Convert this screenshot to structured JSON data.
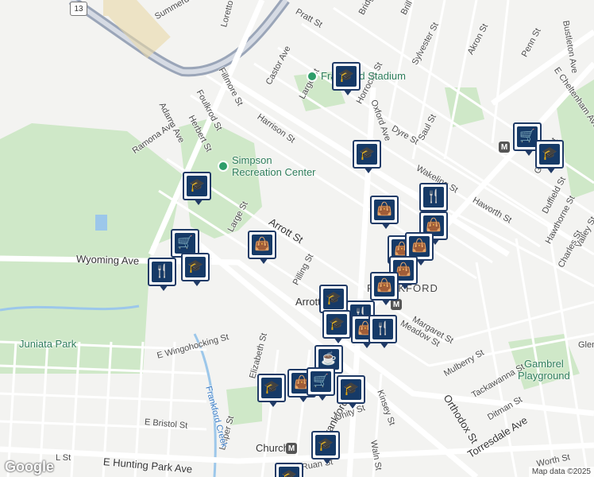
{
  "map": {
    "attribution": "Map data ©2025",
    "logo": "Google",
    "highway_shield": "13",
    "places": [
      {
        "id": "stadium",
        "name": "Frankford Stadium"
      },
      {
        "id": "simpson",
        "name": "Simpson\nRecreation Center"
      },
      {
        "id": "gambrel",
        "name": "Gambrel\nPlayground"
      },
      {
        "id": "juniata",
        "name": "Juniata Park"
      }
    ],
    "neighborhood": "FRANKFORD",
    "stations": [
      "Arrott",
      "Church"
    ],
    "streets": [
      "Summerdale Ave",
      "Pratt St",
      "Castor Ave",
      "Fillmore St",
      "Foulkrod St",
      "Herbert St",
      "Adams Ave",
      "Ramona Ave",
      "Harrison St",
      "Large St",
      "Oxford Ave",
      "Horrocks St",
      "Dyre St",
      "Saul St",
      "Brill St",
      "Sylvester St",
      "Akron St",
      "Penn St",
      "Wakeling St",
      "Haworth St",
      "Arrott St",
      "Wyoming Ave",
      "Pilling St",
      "Margaret St",
      "Orthodox St",
      "Mulberry St",
      "Tackawanna St",
      "Ditman St",
      "Frankford Ave",
      "Kinsey St",
      "Unity St",
      "Waln St",
      "Church",
      "Ruan St",
      "E Hunting Park Ave",
      "E Bristol St",
      "E Wingohocking St",
      "Elizabeth St",
      "Leiper St",
      "Frankford Creek",
      "Torresdale Ave",
      "Worth St",
      "Granite St",
      "Duffield St",
      "Hawthorne St",
      "Valley St",
      "Charles St",
      "E Cheltenham Ave",
      "Bustleton Ave",
      "Meadow St",
      "Large St",
      "L St",
      "Loretto Ave",
      "Bridge St",
      "Glen"
    ],
    "poi_icons": [
      "school-icon",
      "shopping-bag-icon",
      "restaurant-icon",
      "cart-icon",
      "coffee-icon",
      "metro-icon"
    ]
  }
}
